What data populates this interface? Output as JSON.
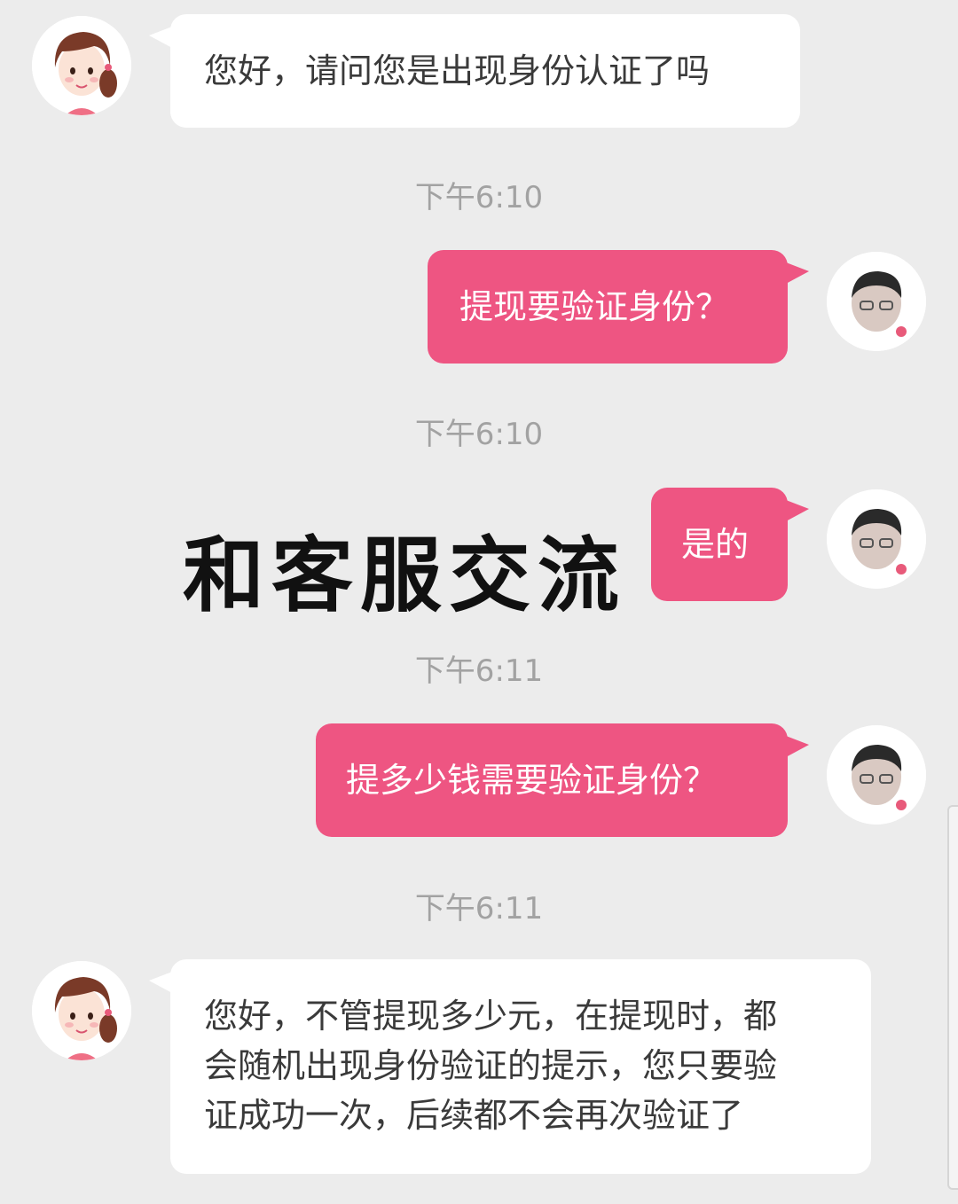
{
  "messages": [
    {
      "sender": "agent",
      "text": "您好，请问您是出现身份认证了吗",
      "avatar_icon": "cartoon-girl-avatar-icon"
    },
    {
      "timestamp": "下午6:10"
    },
    {
      "sender": "user",
      "text": "提现要验证身份？",
      "avatar_icon": "user-avatar-icon"
    },
    {
      "timestamp": "下午6:10"
    },
    {
      "sender": "user",
      "text": "是的",
      "avatar_icon": "user-avatar-icon"
    },
    {
      "timestamp": "下午6:11"
    },
    {
      "sender": "user",
      "text": "提多少钱需要验证身份？",
      "avatar_icon": "user-avatar-icon"
    },
    {
      "timestamp": "下午6:11"
    },
    {
      "sender": "agent",
      "text_lines": [
        "您好，不管提现多少元，在提现时，都",
        "会随机出现身份验证的提示，您只要验",
        "证成功一次，后续都不会再次验证了"
      ],
      "avatar_icon": "cartoon-girl-avatar-icon"
    }
  ],
  "overlay_caption": "和客服交流",
  "colors": {
    "background": "#ececec",
    "user_bubble": "#ee5582",
    "agent_bubble": "#ffffff",
    "timestamp_text": "#a2a2a2"
  }
}
